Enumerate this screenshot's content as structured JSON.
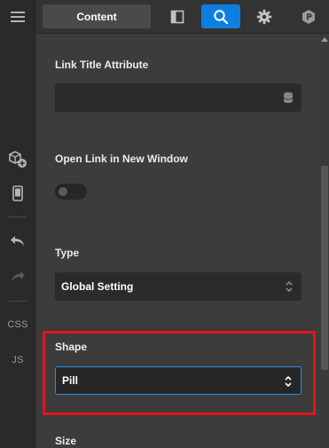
{
  "topbar": {
    "content_tab": "Content",
    "icons": [
      "layout-panel-icon",
      "search-icon",
      "gear-icon",
      "plugin-icon"
    ]
  },
  "left_rail": {
    "items": [
      "menu-icon",
      "add-component-icon",
      "device-preview-icon",
      "undo-icon",
      "redo-icon"
    ],
    "css_label": "CSS",
    "js_label": "JS"
  },
  "panel": {
    "link_title_label": "Link Title Attribute",
    "link_title_value": "",
    "new_window_label": "Open Link in New Window",
    "new_window_enabled": false,
    "type_label": "Type",
    "type_value": "Global Setting",
    "shape_label": "Shape",
    "shape_value": "Pill",
    "size_label": "Size"
  },
  "colors": {
    "accent": "#0d7fe0",
    "highlight": "#e5141b",
    "panel_bg": "#3c3c3c",
    "input_bg": "#2b2b2b"
  }
}
